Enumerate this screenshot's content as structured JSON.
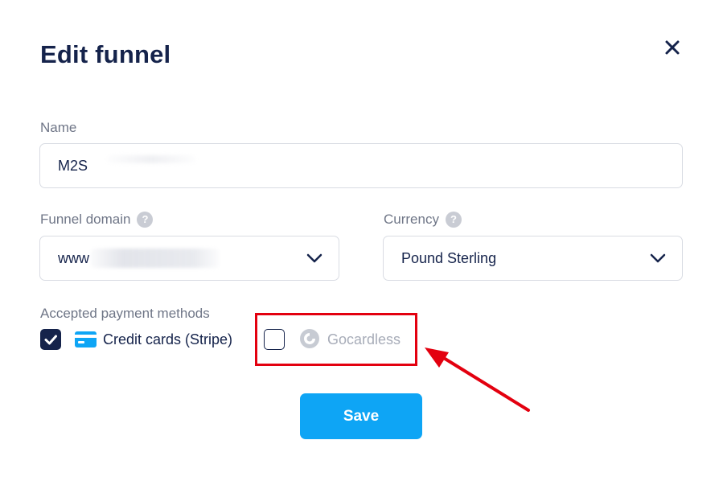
{
  "modal": {
    "title": "Edit funnel",
    "close_icon": "close-icon"
  },
  "name": {
    "label": "Name",
    "value": "M2S"
  },
  "funnel_domain": {
    "label": "Funnel domain",
    "help_icon": "help-icon",
    "value": "www",
    "dropdown_icon": "chevron-down-icon"
  },
  "currency": {
    "label": "Currency",
    "help_icon": "help-icon",
    "value": "Pound Sterling",
    "dropdown_icon": "chevron-down-icon"
  },
  "payment_methods": {
    "label": "Accepted payment methods",
    "options": [
      {
        "label": "Credit cards (Stripe)",
        "checked": true,
        "icon": "credit-card-icon"
      },
      {
        "label": "Gocardless",
        "checked": false,
        "icon": "gocardless-logo-icon"
      }
    ]
  },
  "actions": {
    "save_label": "Save"
  },
  "colors": {
    "primary_text": "#15234b",
    "accent": "#0ea5f5",
    "annotation": "#e3000f"
  }
}
